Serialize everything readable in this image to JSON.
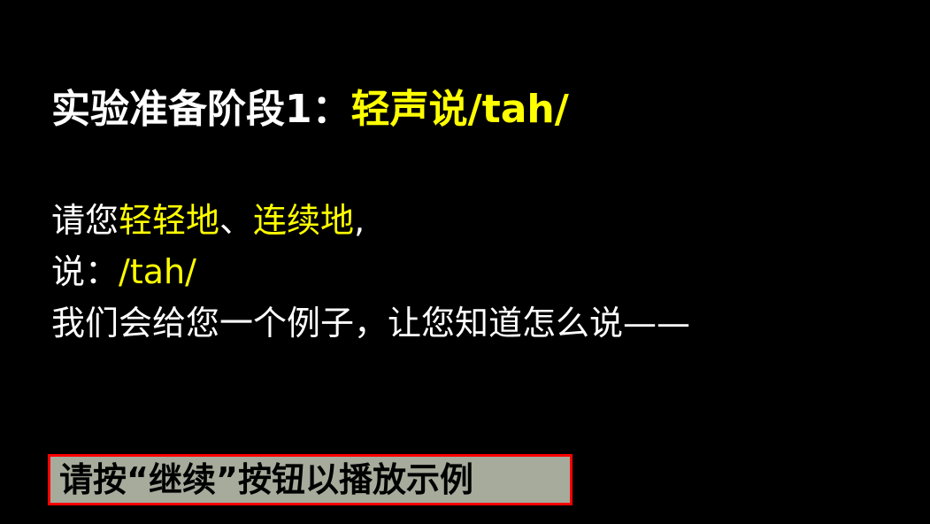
{
  "colors": {
    "background": "#000000",
    "text": "#ffffff",
    "highlight": "#ffff00",
    "instruction_bg": "#a6ab9c",
    "instruction_border": "#ff0000"
  },
  "title": {
    "prefix": "实验准备阶段1：",
    "highlight": "轻声说/tah/"
  },
  "body": {
    "line1": {
      "part1": "请您",
      "part2": "轻轻地",
      "part3": "、",
      "part4": "连续地",
      "part5": ","
    },
    "line2": {
      "part1": "说：",
      "part2": "/tah/"
    },
    "line3": "我们会给您一个例子，让您知道怎么说——"
  },
  "instruction": {
    "text": "请按“继续”按钮以播放示例"
  }
}
